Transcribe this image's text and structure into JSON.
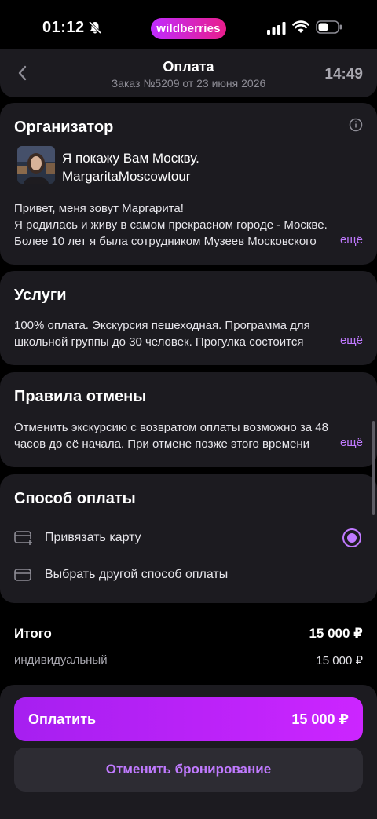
{
  "status": {
    "time": "01:12",
    "brand": "wildberries"
  },
  "header": {
    "title": "Оплата",
    "subtitle": "Заказ №5209 от 23 июня 2026",
    "timer": "14:49"
  },
  "organizer": {
    "title": "Организатор",
    "name_line1": "Я покажу Вам Москву.",
    "name_line2": "MargaritaMoscowtour",
    "desc_line1": "Привет, меня зовут Маргарита!",
    "desc_line2": "Я родилась и живу в самом прекрасном городе - Москве.",
    "desc_line3": "Более 10 лет я была сотрудником Музеев Московского",
    "more": "ещё"
  },
  "services": {
    "title": "Услуги",
    "line1": "100% оплата. Экскурсия пешеходная. Программа для",
    "line2": "школьной группы до 30 человек. Прогулка состоится",
    "more": "ещё"
  },
  "cancel_rules": {
    "title": "Правила отмены",
    "line1": "Отменить экскурсию с возвратом оплаты возможно за 48",
    "line2": "часов до её начала. При отмене позже этого времени",
    "more": "ещё"
  },
  "payment": {
    "title": "Способ оплаты",
    "options": [
      {
        "label": "Привязать карту",
        "selected": true
      },
      {
        "label": "Выбрать другой способ оплаты",
        "selected": false
      }
    ]
  },
  "summary": {
    "total_label": "Итого",
    "total_value": "15 000 ₽",
    "item_label": "индивидуальный",
    "item_value": "15 000 ₽"
  },
  "actions": {
    "pay_label": "Оплатить",
    "pay_amount": "15 000 ₽",
    "cancel_label": "Отменить бронирование"
  },
  "colors": {
    "accent": "#c07aff",
    "button": "#b522f5",
    "card": "#1c1b20"
  }
}
